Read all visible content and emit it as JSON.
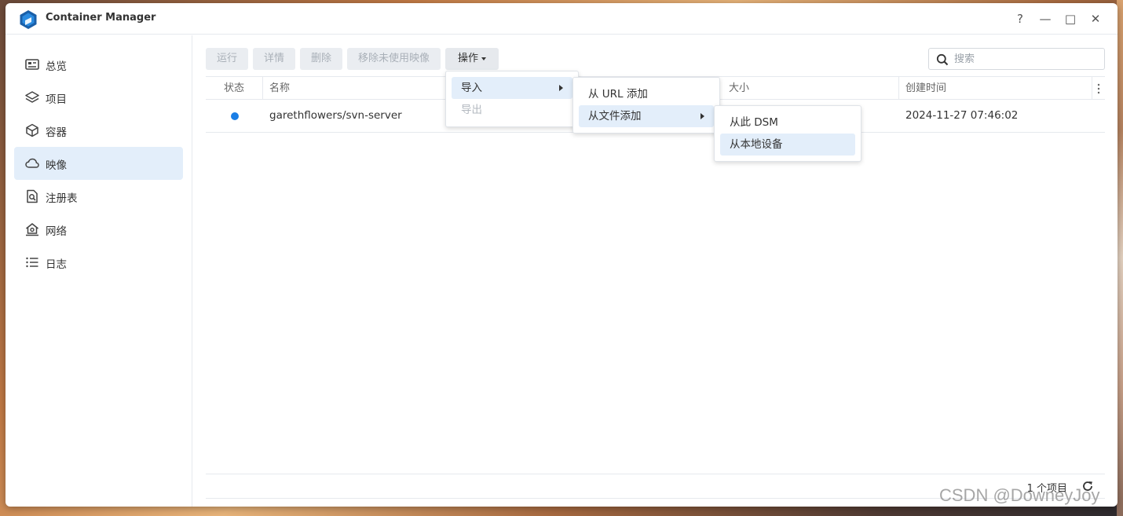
{
  "window": {
    "title": "Container Manager"
  },
  "window_controls": {
    "help": "?",
    "minimize": "—",
    "maximize": "□",
    "close": "✕"
  },
  "sidebar": {
    "items": [
      {
        "label": "总览",
        "icon": "overview-icon",
        "active": false
      },
      {
        "label": "项目",
        "icon": "layers-icon",
        "active": false
      },
      {
        "label": "容器",
        "icon": "cube-icon",
        "active": false
      },
      {
        "label": "映像",
        "icon": "cloud-icon",
        "active": true
      },
      {
        "label": "注册表",
        "icon": "registry-search-icon",
        "active": false
      },
      {
        "label": "网络",
        "icon": "network-home-icon",
        "active": false
      },
      {
        "label": "日志",
        "icon": "list-icon",
        "active": false
      }
    ]
  },
  "toolbar": {
    "run": "运行",
    "details": "详情",
    "delete": "删除",
    "remove_unused": "移除未使用映像",
    "operations": "操作"
  },
  "search": {
    "placeholder": "搜索",
    "value": ""
  },
  "table": {
    "columns": {
      "status": "状态",
      "name": "名称",
      "size": "大小",
      "created": "创建时间"
    },
    "rows": [
      {
        "status": "running",
        "name": "garethflowers/svn-server",
        "size": "",
        "created": "2024-11-27 07:46:02"
      }
    ]
  },
  "footer": {
    "count": "1 个项目"
  },
  "ops_menu": {
    "import": "导入",
    "export": "导出"
  },
  "import_menu": {
    "from_url": "从 URL 添加",
    "from_file": "从文件添加"
  },
  "file_menu": {
    "from_dsm": "从此 DSM",
    "from_local": "从本地设备"
  },
  "watermark": "CSDN @DowneyJoy",
  "colors": {
    "accent": "#1a7ee6",
    "highlight": "#e3eefa",
    "logo": "#1a5fa8"
  }
}
